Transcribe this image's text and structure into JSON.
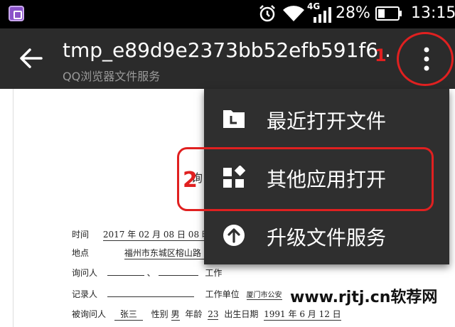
{
  "status_bar": {
    "network": "4G",
    "battery_percent": "28%",
    "time": "13:15"
  },
  "toolbar": {
    "title": "tmp_e89d9e2373bb52efb591f6..",
    "subtitle": "QQ浏览器文件服务"
  },
  "menu": {
    "items": [
      {
        "label": "最近打开文件",
        "icon": "folder-clock-icon"
      },
      {
        "label": "其他应用打开",
        "icon": "apps-grid-icon"
      },
      {
        "label": "升级文件服务",
        "icon": "upgrade-arrow-icon"
      }
    ]
  },
  "annotations": {
    "step1": "1",
    "step2": "2"
  },
  "document": {
    "heading_fragment": "询",
    "rows": [
      {
        "label": "时间",
        "value": "2017 年 02 月 08 日 08 时"
      },
      {
        "label": "地点",
        "value": "福州市东城区榕山路"
      },
      {
        "label": "询问人",
        "value": "、",
        "extra": "工作"
      },
      {
        "label": "记录人",
        "value": "",
        "extra": "工作单位",
        "extra_value": "厦门市公安"
      },
      {
        "label": "被询问人",
        "value": "张三",
        "extra": "性别",
        "extra_value": "男",
        "age_label": "年龄",
        "age": "23",
        "birth_label": "出生日期",
        "birth": "1991 年 6 月 12 日"
      }
    ]
  },
  "watermark": "www.rjtj.cn软荐网"
}
